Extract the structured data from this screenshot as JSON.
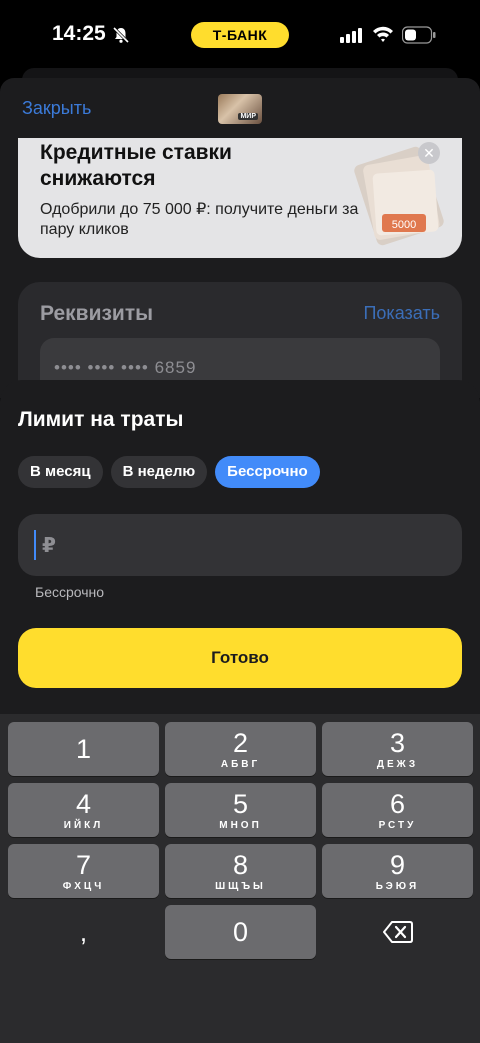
{
  "status_bar": {
    "time": "14:25",
    "carrier_pill": "Т-БАНК",
    "icons": [
      "bell-slash-icon",
      "signal-icon",
      "wifi-icon",
      "battery-icon"
    ]
  },
  "background_sheet": {
    "close_link": "Закрыть",
    "card_thumb_badge": "МИР",
    "banner": {
      "title": "Кредитные ставки снижаются",
      "subtitle": "Одобрили до 75 000 ₽: получите деньги за пару кликов",
      "image_text": "5000"
    },
    "requisites": {
      "title": "Реквизиты",
      "show_link": "Показать",
      "card_number": "•••• •••• •••• 6859"
    }
  },
  "limit_sheet": {
    "title": "Лимит на траты",
    "periods": [
      {
        "label": "В месяц",
        "active": false
      },
      {
        "label": "В неделю",
        "active": false
      },
      {
        "label": "Бессрочно",
        "active": true
      }
    ],
    "amount_placeholder": "₽",
    "hint": "Бессрочно",
    "done_button": "Готово"
  },
  "keypad": {
    "keys": [
      {
        "digit": "1",
        "letters": ""
      },
      {
        "digit": "2",
        "letters": "АБВГ"
      },
      {
        "digit": "3",
        "letters": "ДЕЖЗ"
      },
      {
        "digit": "4",
        "letters": "ИЙКЛ"
      },
      {
        "digit": "5",
        "letters": "МНОП"
      },
      {
        "digit": "6",
        "letters": "РСТУ"
      },
      {
        "digit": "7",
        "letters": "ФХЦЧ"
      },
      {
        "digit": "8",
        "letters": "ШЩЪЫ"
      },
      {
        "digit": "9",
        "letters": "ЬЭЮЯ"
      }
    ],
    "comma": ",",
    "zero": "0",
    "delete_icon": "backspace-icon"
  },
  "colors": {
    "accent_yellow": "#ffdd2d",
    "accent_blue": "#428bf9",
    "link_blue": "#3b7ad8",
    "sheet_bg": "#1c1c1e"
  }
}
